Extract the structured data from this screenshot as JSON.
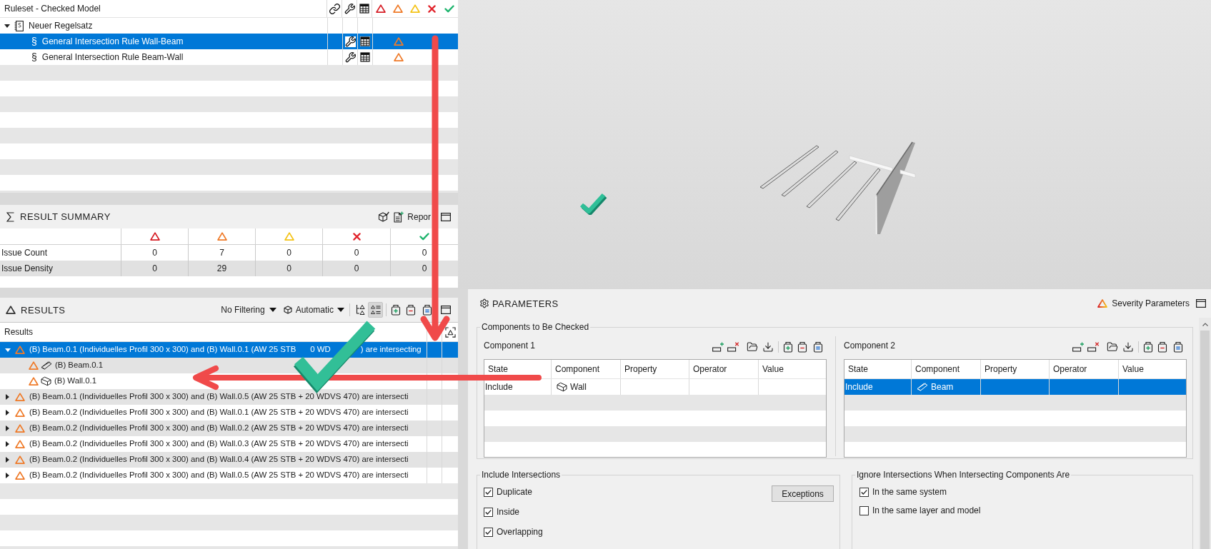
{
  "ruleset": {
    "title": "Ruleset - Checked Model",
    "rows": [
      {
        "label": "Neuer Regelsatz",
        "expanded": true,
        "selected": false,
        "children": [
          {
            "symbol": "§",
            "label": "General Intersection Rule Wall-Beam",
            "selected": true
          },
          {
            "symbol": "§",
            "label": "General Intersection Rule Beam-Wall",
            "selected": false
          }
        ]
      }
    ]
  },
  "result_summary": {
    "title": "RESULT SUMMARY",
    "report": "Repor",
    "rows": [
      {
        "label": "Issue Count",
        "values": [
          "0",
          "7",
          "0",
          "0",
          "0"
        ]
      },
      {
        "label": "Issue Density",
        "values": [
          "0",
          "29",
          "0",
          "0",
          "0"
        ]
      }
    ]
  },
  "results": {
    "title": "RESULTS",
    "filter": "No Filtering",
    "mode": "Automatic",
    "views": [
      {
        "kind": "tree",
        "selected": false
      },
      {
        "kind": "list",
        "selected": true
      }
    ],
    "column": "Results",
    "rows": [
      {
        "label_parts": [
          "(B) Beam.0.1 (Individuelles Profil 300 x 300) and (B) Wall.0.1 (AW 25 STB",
          "0 WD",
          ") are intersecting"
        ],
        "expanded": true,
        "selected": true,
        "children": [
          {
            "kind": "beam",
            "label": "(B) Beam.0.1",
            "selected": false
          },
          {
            "kind": "wall",
            "label": "(B) Wall.0.1",
            "selected": false
          }
        ]
      },
      {
        "label": "(B) Beam.0.1 (Individuelles Profil 300 x 300) and (B) Wall.0.5 (AW 25 STB + 20 WDVS 470) are intersecti",
        "expanded": false,
        "selected": false
      },
      {
        "label": "(B) Beam.0.2 (Individuelles Profil 300 x 300) and (B) Wall.0.1 (AW 25 STB + 20 WDVS 470) are intersecti",
        "expanded": false,
        "selected": false
      },
      {
        "label": "(B) Beam.0.2 (Individuelles Profil 300 x 300) and (B) Wall.0.2 (AW 25 STB + 20 WDVS 470) are intersecti",
        "expanded": false,
        "selected": false
      },
      {
        "label": "(B) Beam.0.2 (Individuelles Profil 300 x 300) and (B) Wall.0.3 (AW 25 STB + 20 WDVS 470) are intersecti",
        "expanded": false,
        "selected": false
      },
      {
        "label": "(B) Beam.0.2 (Individuelles Profil 300 x 300) and (B) Wall.0.4 (AW 25 STB + 20 WDVS 470) are intersecti",
        "expanded": false,
        "selected": false
      },
      {
        "label": "(B) Beam.0.2 (Individuelles Profil 300 x 300) and (B) Wall.0.5 (AW 25 STB + 20 WDVS 470) are intersecti",
        "expanded": false,
        "selected": false
      }
    ]
  },
  "parameters": {
    "title": "PARAMETERS",
    "severity_button": "Severity Parameters",
    "components_title": "Components to Be Checked",
    "components": [
      {
        "title": "Component 1",
        "columns": [
          "State",
          "Component",
          "Property",
          "Operator",
          "Value"
        ],
        "rows": [
          {
            "state": "Include",
            "kind": "wall",
            "component": "Wall",
            "selected": false
          }
        ]
      },
      {
        "title": "Component 2",
        "columns": [
          "State",
          "Component",
          "Property",
          "Operator",
          "Value"
        ],
        "rows": [
          {
            "state": "Include",
            "kind": "beam",
            "component": "Beam",
            "selected": true
          }
        ]
      }
    ],
    "include": {
      "title": "Include Intersections",
      "options": [
        {
          "label": "Duplicate",
          "checked": true
        },
        {
          "label": "Inside",
          "checked": true
        },
        {
          "label": "Overlapping",
          "checked": true
        }
      ],
      "button": "Exceptions"
    },
    "ignore": {
      "title": "Ignore Intersections When Intersecting Components Are",
      "options": [
        {
          "label": "In the same system",
          "checked": true
        },
        {
          "label": "In the same layer and model",
          "checked": false
        }
      ]
    }
  }
}
